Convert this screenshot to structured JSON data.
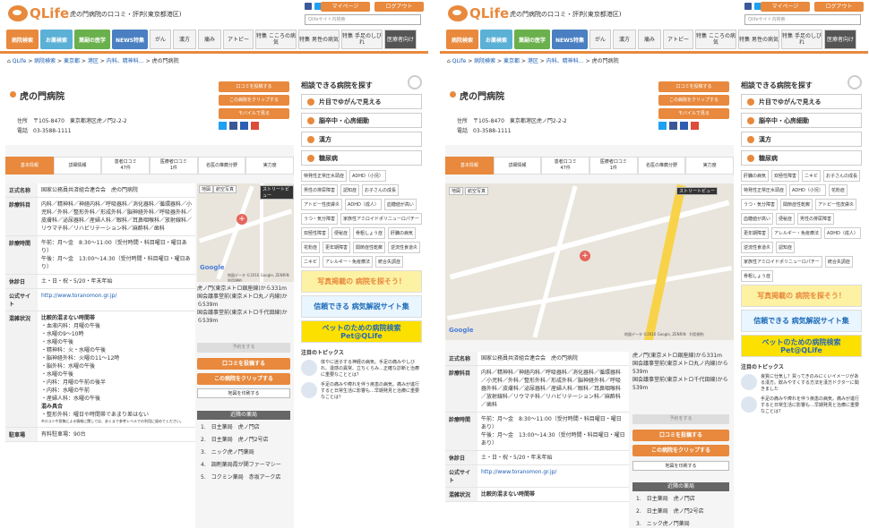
{
  "header": {
    "logo_text": "QLife",
    "tagline": "虎の門病院の口コミ・評判(東京都港区)",
    "mypage": "マイページ",
    "logout": "ログアウト",
    "search_placeholder": "Qlifeサイト内検索"
  },
  "nav": {
    "main": [
      "病院検索",
      "お薬検索",
      "葉副の医学",
      "NEWS特集"
    ],
    "categories": [
      "がん",
      "漢方",
      "痛み",
      "アトピー",
      "特集 こころの病気",
      "特集 男性の病気",
      "特集 手足のしびれ",
      "医療者向け"
    ]
  },
  "breadcrumb": [
    "QLife",
    "病院検索",
    "東京都",
    "港区",
    "内科、精神科…",
    "虎の門病院"
  ],
  "hospital": {
    "name": "虎の門病院",
    "address_label": "住所",
    "address": "〒105-8470　東京都港区虎ノ門2-2-2",
    "phone_label": "電話",
    "phone": "03-3588-1111",
    "actions": [
      "口コミを投稿する",
      "この病院をクリップする",
      "モバイルで見る"
    ]
  },
  "tabs": [
    {
      "label": "基本情報"
    },
    {
      "label": "詳細情報"
    },
    {
      "label": "患者口コミ",
      "count": "47件"
    },
    {
      "label": "医療者口コミ",
      "count": "1件"
    },
    {
      "label": "名医の推薦分野"
    },
    {
      "label": "実力度"
    }
  ],
  "details": {
    "official_name_label": "正式名称",
    "official_name": "国家公務員共済組合連合会　虎の門病院",
    "depts_label": "診療科目",
    "depts": "内科／精神科／神経内科／呼吸器科／消化器科／循環器科／小児科／外科／整形外科／形成外科／脳神経外科／呼吸器外科／皮膚科／泌尿器科／産婦人科／眼科／耳鼻咽喉科／放射線科／リウマチ科／リハビリテーション科／麻酔科／歯科",
    "hours_label": "診療時間",
    "hours": "午前：月～金　8:30～11:00（受付時間・科目曜日・曜日あり）\n午後：月～金　13:00～14:30（受付時間・科目曜日・曜日あり）",
    "closed_label": "休診日",
    "closed": "土・日・祝・5/20・年末年始",
    "site_label": "公式サイト",
    "site": "http://www.toranomon.gr.jp/",
    "status_label": "混雑状況",
    "status_title": "比較的混まない時間帯",
    "status_lines": [
      "・血液内科：月曜の午後",
      "・水曜の9～10時",
      "・水曜の午後",
      "・精神科：火・水曜の午後",
      "・脳神経外科：火曜の11～12時",
      "・脳外科：水曜の午後",
      "・水曜の午後",
      "・内科：月曜の午前の後半",
      "・内科：水曜の午前",
      "・産婦人科：水曜の午後"
    ],
    "busy_title": "混み具合",
    "busy_line": "・整形外科：曜日や時間帯であまり差はない",
    "note": "※口コミや投稿による情報に関しては、あくまで参考レベルでの利用に留めてください。",
    "parking_label": "駐車場",
    "parking": "有料駐車場：90台"
  },
  "map": {
    "map_label": "地図",
    "satellite_label": "航空写真",
    "streetview_label": "ストリートビュー",
    "google": "Google",
    "footer": "地図データ ©2016 Google, ZENRIN　利用規約"
  },
  "access": "虎ノ門(東京メトロ銀座線)から331m\n国会議事堂前(東京メトロ丸ノ内線)から539m\n国会議事堂前(東京メトロ千代田線)から539m",
  "buttons": {
    "reserve": "予約をする",
    "post": "口コミを投稿する",
    "clip": "この病院をクリップする",
    "print": "地図を印刷する"
  },
  "nearby": {
    "title": "近隣の薬局",
    "items": [
      "1.　日主薬局　虎ノ門店",
      "2.　日主薬局　虎ノ門2号店",
      "3.　ニック虎ノ門薬局",
      "4.　調剤薬局霞が関ファーマシー",
      "5.　コクミン薬局　赤坂アーク店"
    ]
  },
  "side": {
    "title": "相談できる病院を探す",
    "buttons": [
      "片目でゆがんで見える",
      "脳卒中・心房細動",
      "漢方",
      "糖尿病"
    ],
    "tags_a": [
      "特発性正常圧水頭症",
      "ADHD（小児）",
      "男性の排尿障害",
      "認知症",
      "お子さんの成長",
      "アトピー性皮膚炎",
      "ADHD（成人）",
      "血糖値が高い",
      "うつ・気分障害",
      "家族性アミロイドポリニューロパチー",
      "双極性障害",
      "便秘症",
      "骨粗しょう症",
      "肝臓の病気",
      "花粉症",
      "更年期障害",
      "関節症性乾癬",
      "逆流性食道炎",
      "ニキビ",
      "アレルギー・免疫療法",
      "統合失調症"
    ],
    "tags_b": [
      "肝臓の病気",
      "双極性障害",
      "ニキビ",
      "お子さんの成長",
      "特発性正常圧水頭症",
      "ADHD（小児）",
      "花粉症",
      "うつ・気分障害",
      "関節症性乾癬",
      "アトピー性皮膚炎",
      "血糖値が高い",
      "便秘症",
      "男性の排尿障害",
      "更年期障害",
      "アレルギー・免疫療法",
      "ADHD（成人）",
      "逆流性食道炎",
      "認知症",
      "家族性アミロイドポリニューロパチー",
      "統合失調症",
      "骨粗しょう症"
    ],
    "banners": [
      "写真掲載の 病院を探そう！",
      "信頼できる 病気解説サイト集",
      "ペットのための病院検索 Pet@QLife"
    ],
    "topics_title": "注目のトピックス",
    "topics": [
      "体やに迷子する神経の病気。手足の痛みやしびれ、違感の異常、立ちくらみ…正確な診断と治療に重要なこととは？",
      "手足の痛みや痺れを伴う疾患の病気。痛みが進行すると日常生活に影響も…早期発見と治療に重要なことは？"
    ],
    "topics_b": [
      "良質に仕気し？買ってきのみにくいイメージがある漢方。飲みやすくする方法を漢方ドクターに聞きました",
      "手足の痛みや痺れを伴う疾患の病気。痛みが進行すると日常生活に影響も…早期発見と治療に重要なことは？"
    ]
  },
  "colors": {
    "accent": "#e8893d",
    "link": "#1b5db2"
  }
}
